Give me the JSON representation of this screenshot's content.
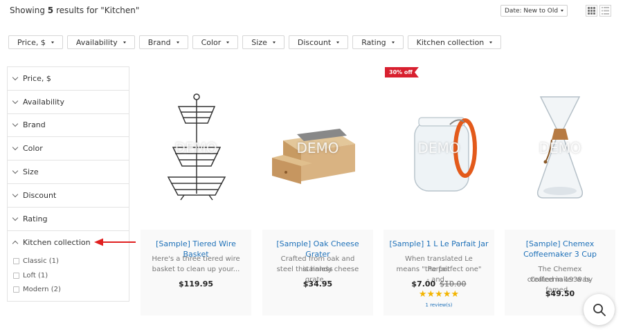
{
  "header": {
    "results_prefix": "Showing",
    "results_count": "5",
    "results_suffix": "results for \"Kitchen\"",
    "sort_label": "Date: New to Old"
  },
  "filters": [
    "Price, $",
    "Availability",
    "Brand",
    "Color",
    "Size",
    "Discount",
    "Rating",
    "Kitchen collection"
  ],
  "sidebar": {
    "sections": [
      "Price, $",
      "Availability",
      "Brand",
      "Color",
      "Size",
      "Discount",
      "Rating"
    ],
    "open_section": "Kitchen collection",
    "options": [
      "Classic (1)",
      "Loft (1)",
      "Modern (2)"
    ]
  },
  "products": [
    {
      "title": "[Sample] Tiered Wire Basket",
      "desc_1": "Here's a three tiered wire",
      "desc_2": "basket to clean up your...",
      "price": "$119.95",
      "watermark": "DEMO"
    },
    {
      "title": "[Sample] Oak Cheese Grater",
      "desc_1": "Crafted from oak and stainless",
      "desc_2": "steel this handy cheese grate...",
      "price": "$34.95",
      "watermark": "DEMO"
    },
    {
      "title": "[Sample] 1 L Le Parfait Jar",
      "desc_1": "When translated Le Parfait",
      "desc_2": "means \"the perfect one\" - and...",
      "price": "$7.00",
      "old_price": "$10.00",
      "badge": "30% off",
      "stars": "★★★★★",
      "rating": 5,
      "reviews": "1 review(s)",
      "watermark": "DEMO"
    },
    {
      "title_1": "[Sample] Chemex",
      "title_2": "Coffeemaker 3 Cup",
      "desc_1": "The Chemex Coffeemaker was",
      "desc_2": "created in 1939 by famed...",
      "price": "$49.50",
      "watermark": "DEMO"
    }
  ],
  "colors": {
    "link": "#1d70b8",
    "badge": "#d8202f",
    "arrow": "#e02020",
    "star": "#f3b400"
  },
  "icons": {
    "grid_view": "grid-icon",
    "list_view": "list-icon",
    "search": "search-icon",
    "pointer": "arrow-icon"
  }
}
